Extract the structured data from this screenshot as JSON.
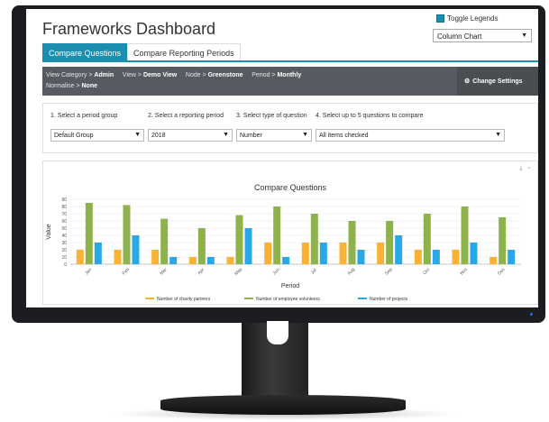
{
  "app": {
    "title": "Frameworks Dashboard",
    "toggle_legends": "Toggle Legends",
    "chart_type": "Column Chart"
  },
  "tabs": [
    {
      "label": "Compare Questions",
      "active": true
    },
    {
      "label": "Compare Reporting Periods",
      "active": false
    }
  ],
  "infobar": {
    "view_category_label": "View Category",
    "view_category_value": "Admin",
    "view_label": "View",
    "view_value": "Demo View",
    "node_label": "Node",
    "node_value": "Greenstone",
    "period_label": "Period",
    "period_value": "Monthly",
    "normalise_label": "Normalise",
    "normalise_value": "None",
    "change_settings": "Change Settings"
  },
  "filters": [
    {
      "label": "1. Select a period group",
      "value": "Default Group"
    },
    {
      "label": "2. Select a reporting period",
      "value": "2018"
    },
    {
      "label": "3. Select type of question",
      "value": "Number"
    },
    {
      "label": "4. Select up to 5 questions to compare",
      "value": "All items checked"
    }
  ],
  "colors": {
    "accent": "#1c8fb0",
    "orange": "#f9b233",
    "green": "#8db34a",
    "blue": "#29a8e8"
  },
  "chart_data": {
    "type": "bar",
    "title": "Compare Questions",
    "xlabel": "Period",
    "ylabel": "Value",
    "ylim": [
      0,
      90
    ],
    "yticks": [
      0,
      10,
      20,
      30,
      40,
      50,
      60,
      70,
      80,
      90
    ],
    "grid": true,
    "legend": "bottom",
    "categories": [
      "Jan",
      "Feb",
      "Mar",
      "Apr",
      "May",
      "Jun",
      "Jul",
      "Aug",
      "Sep",
      "Oct",
      "Nov",
      "Dec"
    ],
    "series": [
      {
        "name": "Number of charity partners",
        "color": "#f9b233",
        "values": [
          20,
          20,
          20,
          10,
          10,
          30,
          30,
          30,
          30,
          20,
          20,
          10
        ]
      },
      {
        "name": "Number of employee volunteers",
        "color": "#8db34a",
        "values": [
          85,
          82,
          63,
          50,
          68,
          80,
          70,
          60,
          60,
          70,
          80,
          65
        ]
      },
      {
        "name": "Number of projects",
        "color": "#29a8e8",
        "values": [
          30,
          40,
          10,
          10,
          50,
          10,
          30,
          20,
          40,
          20,
          30,
          20
        ]
      }
    ]
  }
}
